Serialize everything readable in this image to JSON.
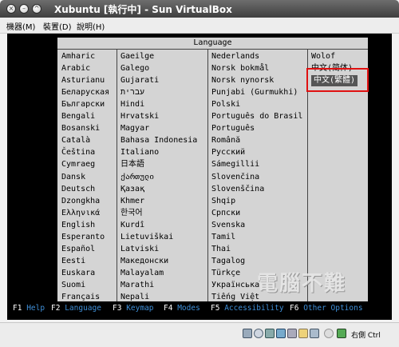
{
  "window": {
    "title": "Xubuntu [執行中] - Sun VirtualBox"
  },
  "menu": [
    "機器(M)",
    "裝置(D)",
    "說明(H)"
  ],
  "language_menu": {
    "header": "Language",
    "columns": [
      [
        "Amharic",
        "Arabic",
        "Asturianu",
        "Беларуская",
        "Български",
        "Bengali",
        "Bosanski",
        "Català",
        "Čeština",
        "Cymraeg",
        "Dansk",
        "Deutsch",
        "Dzongkha",
        "Ελληνικά",
        "English",
        "Esperanto",
        "Español",
        "Eesti",
        "Euskara",
        "Suomi",
        "Français"
      ],
      [
        "Gaeilge",
        "Galego",
        "Gujarati",
        "עברית",
        "Hindi",
        "Hrvatski",
        "Magyar",
        "Bahasa Indonesia",
        "Italiano",
        "日本語",
        "ქართული",
        "Қазақ",
        "Khmer",
        "한국어",
        "Kurdî",
        "Lietuviškai",
        "Latviski",
        "Македонски",
        "Malayalam",
        "Marathi",
        "Nepali"
      ],
      [
        "Nederlands",
        "Norsk bokmål",
        "Norsk nynorsk",
        "Punjabi (Gurmukhi)",
        "Polski",
        "Português do Brasil",
        "Português",
        "Română",
        "Русский",
        "Sámegillii",
        "Slovenčina",
        "Slovenščina",
        "Shqip",
        "Српски",
        "Svenska",
        "Tamil",
        "Thai",
        "Tagalog",
        "Türkçe",
        "Українська",
        "Tiếng Việt"
      ],
      [
        "Wolof",
        "中文(简体)",
        "中文(繁體)"
      ]
    ],
    "selected": "中文(繁體)"
  },
  "function_keys": [
    {
      "key": "F1",
      "name": "Help"
    },
    {
      "key": "F2",
      "name": "Language"
    },
    {
      "key": "F3",
      "name": "Keymap"
    },
    {
      "key": "F4",
      "name": "Modes"
    },
    {
      "key": "F5",
      "name": "Accessibility"
    },
    {
      "key": "F6",
      "name": "Other Options"
    }
  ],
  "watermark": "電腦不難",
  "status": {
    "host_key_label": "右側 Ctrl"
  }
}
